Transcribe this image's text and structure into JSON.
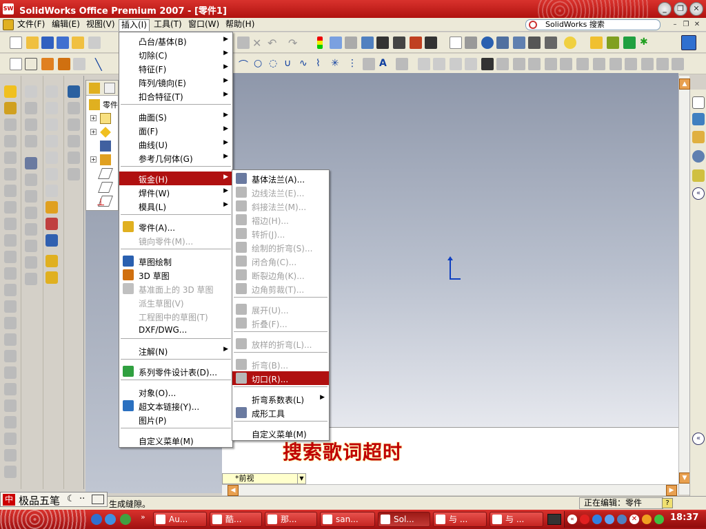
{
  "window": {
    "title": "SolidWorks Office Premium 2007 - [零件1]",
    "app_icon_text": "SW"
  },
  "menubar": {
    "items": [
      "文件(F)",
      "编辑(E)",
      "视图(V)",
      "插入(I)",
      "工具(T)",
      "窗口(W)",
      "帮助(H)"
    ],
    "active_index": 3,
    "search_placeholder": "SolidWorks 搜索"
  },
  "insert_menu": {
    "items": [
      {
        "label": "凸台/基体(B)",
        "submenu": true,
        "disabled": false,
        "icon": null
      },
      {
        "label": "切除(C)",
        "submenu": true,
        "disabled": false,
        "icon": null
      },
      {
        "label": "特征(F)",
        "submenu": true,
        "disabled": false,
        "icon": null
      },
      {
        "label": "阵列/镜向(E)",
        "submenu": true,
        "disabled": false,
        "icon": null
      },
      {
        "label": "扣合特征(T)",
        "submenu": true,
        "disabled": false,
        "icon": null
      },
      {
        "label": "曲面(S)",
        "submenu": true,
        "disabled": false,
        "icon": null
      },
      {
        "label": "面(F)",
        "submenu": true,
        "disabled": false,
        "icon": null
      },
      {
        "label": "曲线(U)",
        "submenu": true,
        "disabled": false,
        "icon": null
      },
      {
        "label": "参考几何体(G)",
        "submenu": true,
        "disabled": false,
        "icon": null
      },
      {
        "label": "钣金(H)",
        "submenu": true,
        "disabled": false,
        "icon": null,
        "highlighted": true
      },
      {
        "label": "焊件(W)",
        "submenu": true,
        "disabled": false,
        "icon": null
      },
      {
        "label": "模具(L)",
        "submenu": true,
        "disabled": false,
        "icon": null
      },
      {
        "label": "零件(A)...",
        "submenu": false,
        "disabled": false,
        "icon": "part-icon"
      },
      {
        "label": "镜向零件(M)...",
        "submenu": false,
        "disabled": true,
        "icon": null
      },
      {
        "label": "草图绘制",
        "submenu": false,
        "disabled": false,
        "icon": "sketch-icon"
      },
      {
        "label": "3D 草图",
        "submenu": false,
        "disabled": false,
        "icon": "3d-sketch-icon"
      },
      {
        "label": "基准面上的 3D 草图",
        "submenu": false,
        "disabled": true,
        "icon": "3d-sketch-plane-icon"
      },
      {
        "label": "派生草图(V)",
        "submenu": false,
        "disabled": true,
        "icon": null
      },
      {
        "label": "工程图中的草图(T)",
        "submenu": false,
        "disabled": true,
        "icon": null
      },
      {
        "label": "DXF/DWG...",
        "submenu": false,
        "disabled": false,
        "icon": null
      },
      {
        "label": "注解(N)",
        "submenu": true,
        "disabled": false,
        "icon": null
      },
      {
        "label": "系列零件设计表(D)...",
        "submenu": false,
        "disabled": false,
        "icon": "design-table-icon"
      },
      {
        "label": "对象(O)...",
        "submenu": false,
        "disabled": false,
        "icon": null
      },
      {
        "label": "超文本链接(Y)...",
        "submenu": false,
        "disabled": false,
        "icon": "hyperlink-globe-icon"
      },
      {
        "label": "图片(P)",
        "submenu": false,
        "disabled": false,
        "icon": null
      },
      {
        "label": "自定义菜单(M)",
        "submenu": false,
        "disabled": false,
        "icon": null
      }
    ]
  },
  "sheetmetal_menu": {
    "items": [
      {
        "label": "基体法兰(A)...",
        "disabled": false,
        "submenu": false
      },
      {
        "label": "边线法兰(E)...",
        "disabled": true,
        "submenu": false
      },
      {
        "label": "斜接法兰(M)...",
        "disabled": true,
        "submenu": false
      },
      {
        "label": "褶边(H)...",
        "disabled": true,
        "submenu": false
      },
      {
        "label": "转折(J)...",
        "disabled": true,
        "submenu": false
      },
      {
        "label": "绘制的折弯(S)...",
        "disabled": true,
        "submenu": false
      },
      {
        "label": "闭合角(C)...",
        "disabled": true,
        "submenu": false
      },
      {
        "label": "断裂边角(K)...",
        "disabled": true,
        "submenu": false
      },
      {
        "label": "边角剪裁(T)...",
        "disabled": true,
        "submenu": false
      },
      {
        "label": "展开(U)...",
        "disabled": true,
        "submenu": false
      },
      {
        "label": "折叠(F)...",
        "disabled": true,
        "submenu": false
      },
      {
        "label": "放样的折弯(L)...",
        "disabled": true,
        "submenu": false
      },
      {
        "label": "折弯(B)...",
        "disabled": true,
        "submenu": false
      },
      {
        "label": "切口(R)...",
        "disabled": true,
        "submenu": false,
        "highlighted": true
      },
      {
        "label": "折弯系数表(L)",
        "disabled": false,
        "submenu": true
      },
      {
        "label": "成形工具",
        "disabled": false,
        "submenu": false
      },
      {
        "label": "自定义菜单(M)",
        "disabled": false,
        "submenu": false
      }
    ]
  },
  "feature_manager": {
    "tab_label": "零件"
  },
  "lyrics_overlay": "搜索歌词超时",
  "view_tab": {
    "label": "*前视"
  },
  "statusbar": {
    "message": "生成缝隙。",
    "editing": "正在编辑：零件",
    "help": "?"
  },
  "ime": {
    "logo": "中",
    "name": "极品五笔"
  },
  "taskbar": {
    "buttons": [
      "Au...",
      "酷...",
      "那...",
      "san...",
      "Sol...",
      "与 ...",
      "与 ..."
    ],
    "active_index": 4,
    "clock": "18:37"
  },
  "colors": {
    "titlebar": "#c01a16",
    "menu_highlight": "#b01010",
    "lyrics": "#c00000",
    "triad": "#1040c0"
  }
}
